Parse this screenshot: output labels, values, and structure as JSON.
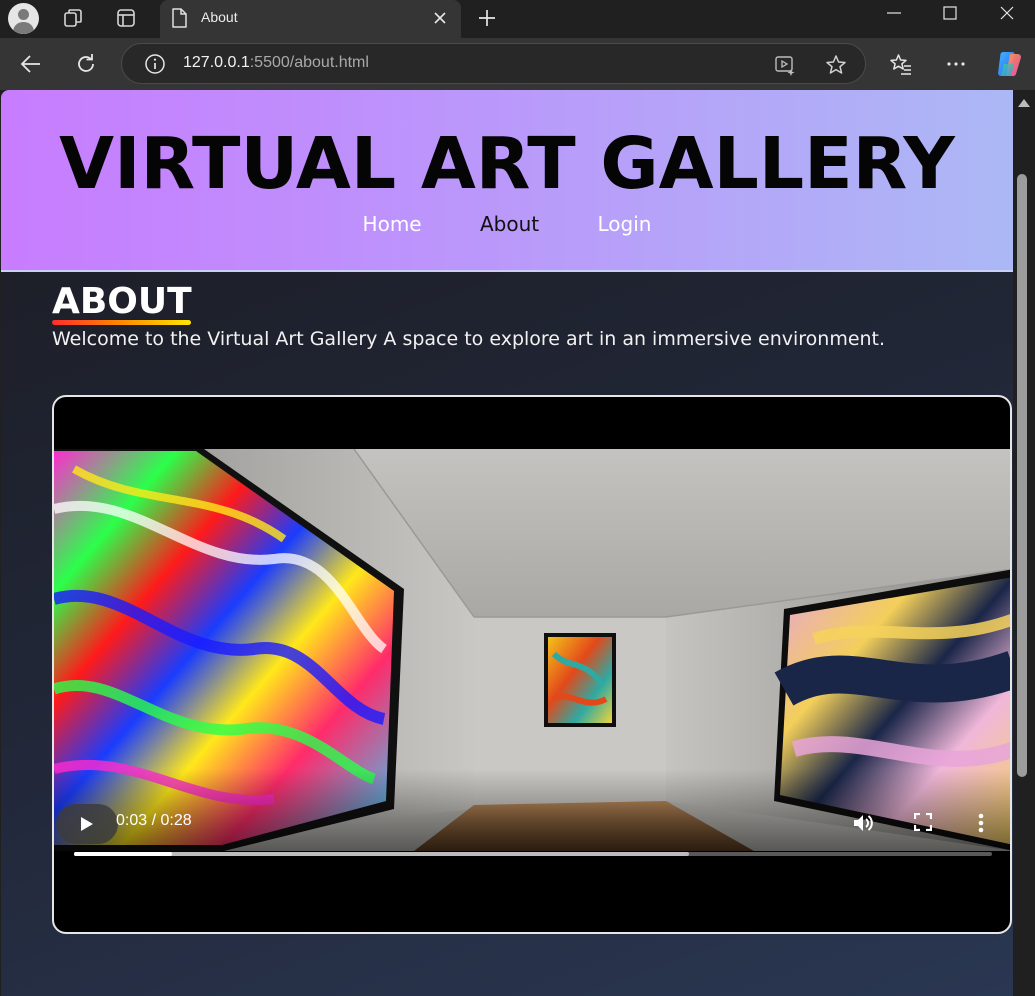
{
  "browser": {
    "tab_title": "About",
    "url_host": "127.0.0.1",
    "url_rest": ":5500/about.html"
  },
  "site": {
    "title": "VIRTUAL ART GALLERY",
    "nav": [
      {
        "label": "Home",
        "active": false
      },
      {
        "label": "About",
        "active": true
      },
      {
        "label": "Login",
        "active": false
      }
    ]
  },
  "about": {
    "heading": "ABOUT",
    "intro": "Welcome to the Virtual Art Gallery A space to explore art in an immersive environment."
  },
  "video": {
    "time": "0:03 / 0:28",
    "current_seconds": 3,
    "duration_seconds": 28,
    "buffered_fraction": 0.67
  },
  "colors": {
    "hero_start": "#c87cff",
    "hero_end": "#acb8f5",
    "underline": [
      "#ff2d2d",
      "#ff8a00",
      "#ffe600"
    ]
  },
  "icons": [
    "profile-icon",
    "workspaces-icon",
    "tab-actions-icon",
    "page-icon",
    "close-icon",
    "plus-icon",
    "minimize-icon",
    "maximize-icon",
    "back-arrow-icon",
    "reload-icon",
    "info-icon",
    "reader-icon",
    "star-icon",
    "favorites-icon",
    "more-icon",
    "copilot-icon",
    "play-icon",
    "volume-icon",
    "fullscreen-icon",
    "kebab-icon"
  ]
}
